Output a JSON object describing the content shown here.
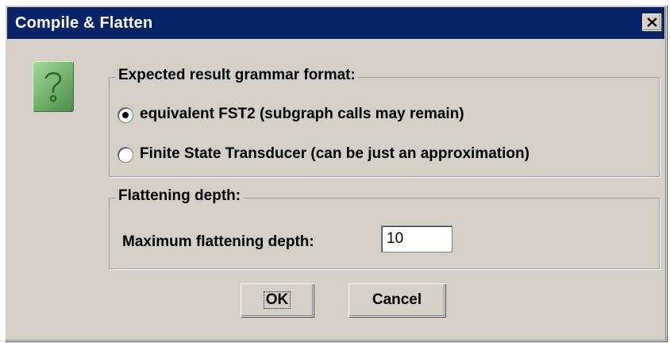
{
  "window": {
    "title": "Compile & Flatten",
    "close_icon": "close-x-icon"
  },
  "dialog": {
    "icon": "question-icon",
    "format_group": {
      "legend": "Expected result grammar format:",
      "options": [
        {
          "label": "equivalent FST2 (subgraph calls may remain)",
          "selected": true
        },
        {
          "label": "Finite State Transducer (can be just an approximation)",
          "selected": false
        }
      ]
    },
    "depth_group": {
      "legend": "Flattening depth:",
      "field_label": "Maximum flattening depth:",
      "field_value": "10"
    },
    "buttons": {
      "ok_label": "OK",
      "cancel_label": "Cancel"
    }
  },
  "colors": {
    "titlebar": "#0a246a",
    "dialog_bg": "#d4d0c8",
    "icon_green": "#6fb06a"
  }
}
